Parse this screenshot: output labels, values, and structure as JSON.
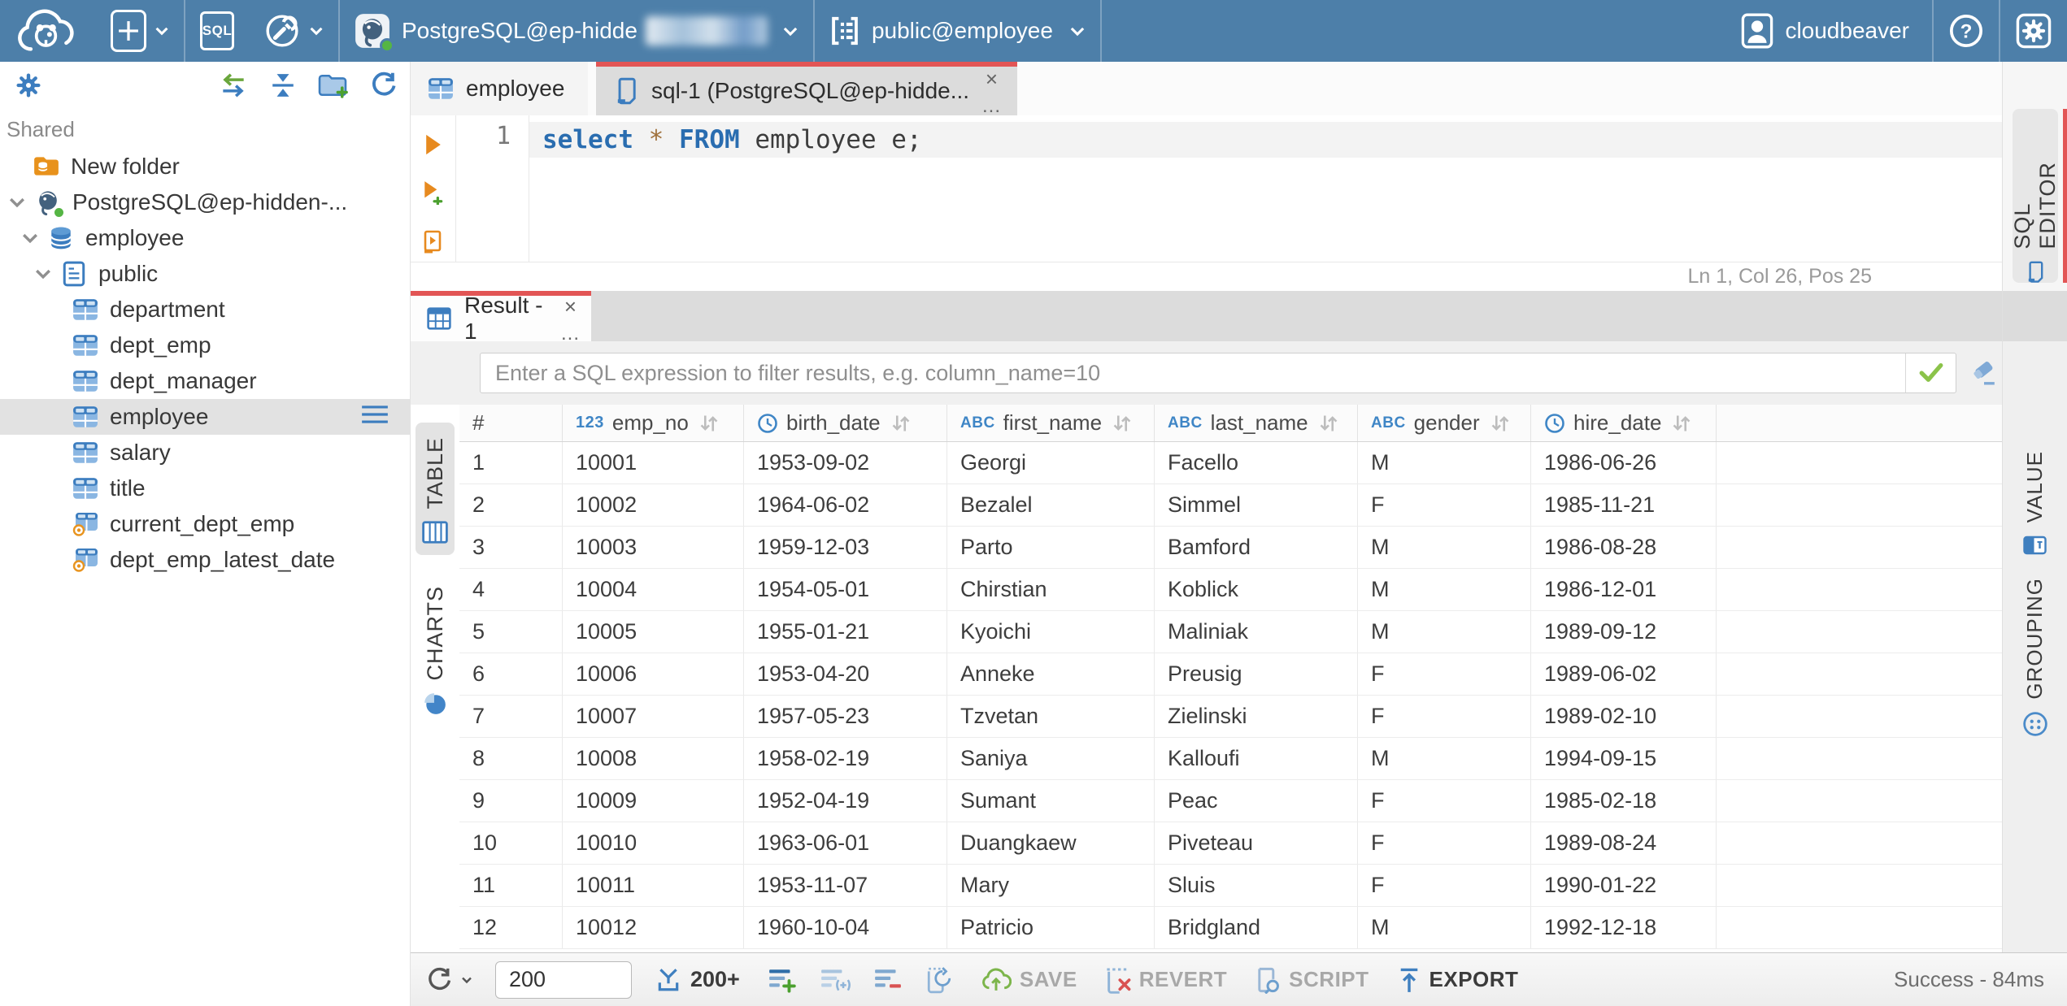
{
  "glyphs": {
    "close": "×",
    "more": "...",
    "hash": "#",
    "question": "?"
  },
  "topbar": {
    "sql_button_label": "SQL",
    "connection_label": "PostgreSQL@ep-hidde",
    "schema_label": "public@employee",
    "user_label": "cloudbeaver"
  },
  "sidebar": {
    "section_label": "Shared",
    "items": [
      {
        "label": "New folder"
      },
      {
        "label": "PostgreSQL@ep-hidden-..."
      },
      {
        "label": "employee"
      },
      {
        "label": "public"
      },
      {
        "label": "department"
      },
      {
        "label": "dept_emp"
      },
      {
        "label": "dept_manager"
      },
      {
        "label": "employee"
      },
      {
        "label": "salary"
      },
      {
        "label": "title"
      },
      {
        "label": "current_dept_emp"
      },
      {
        "label": "dept_emp_latest_date"
      }
    ]
  },
  "editor": {
    "tabs": [
      {
        "label": "employee"
      },
      {
        "label": "sql-1 (PostgreSQL@ep-hidde..."
      }
    ],
    "line_number": "1",
    "sql": {
      "kw1": "select",
      "star": "*",
      "kw2": "FROM",
      "rest": " employee e;"
    },
    "status_line": "Ln 1, Col 26, Pos 25"
  },
  "results": {
    "tab_label": "Result - 1",
    "filter_placeholder": "Enter a SQL expression to filter results, e.g. column_name=10",
    "table_tab": "TABLE",
    "charts_tab": "CHARTS",
    "type_badges": {
      "number": "123",
      "string": "ABC"
    },
    "columns": [
      {
        "name": "emp_no",
        "type": "number"
      },
      {
        "name": "birth_date",
        "type": "date"
      },
      {
        "name": "first_name",
        "type": "string"
      },
      {
        "name": "last_name",
        "type": "string"
      },
      {
        "name": "gender",
        "type": "string"
      },
      {
        "name": "hire_date",
        "type": "date"
      }
    ],
    "rows": [
      [
        "1",
        "10001",
        "1953-09-02",
        "Georgi",
        "Facello",
        "M",
        "1986-06-26"
      ],
      [
        "2",
        "10002",
        "1964-06-02",
        "Bezalel",
        "Simmel",
        "F",
        "1985-11-21"
      ],
      [
        "3",
        "10003",
        "1959-12-03",
        "Parto",
        "Bamford",
        "M",
        "1986-08-28"
      ],
      [
        "4",
        "10004",
        "1954-05-01",
        "Chirstian",
        "Koblick",
        "M",
        "1986-12-01"
      ],
      [
        "5",
        "10005",
        "1955-01-21",
        "Kyoichi",
        "Maliniak",
        "M",
        "1989-09-12"
      ],
      [
        "6",
        "10006",
        "1953-04-20",
        "Anneke",
        "Preusig",
        "F",
        "1989-06-02"
      ],
      [
        "7",
        "10007",
        "1957-05-23",
        "Tzvetan",
        "Zielinski",
        "F",
        "1989-02-10"
      ],
      [
        "8",
        "10008",
        "1958-02-19",
        "Saniya",
        "Kalloufi",
        "M",
        "1994-09-15"
      ],
      [
        "9",
        "10009",
        "1952-04-19",
        "Sumant",
        "Peac",
        "F",
        "1985-02-18"
      ],
      [
        "10",
        "10010",
        "1963-06-01",
        "Duangkaew",
        "Piveteau",
        "F",
        "1989-08-24"
      ],
      [
        "11",
        "10011",
        "1953-11-07",
        "Mary",
        "Sluis",
        "F",
        "1990-01-22"
      ],
      [
        "12",
        "10012",
        "1960-10-04",
        "Patricio",
        "Bridgland",
        "M",
        "1992-12-18"
      ]
    ]
  },
  "toolbar": {
    "row_limit": "200",
    "fetch_more_label": "200+",
    "save_label": "SAVE",
    "revert_label": "REVERT",
    "script_label": "SCRIPT",
    "export_label": "EXPORT",
    "status": "Success - 84ms"
  },
  "right_rail": {
    "sql_editor_tab": "SQL EDITOR",
    "value_tab": "VALUE",
    "grouping_tab": "GROUPING"
  }
}
